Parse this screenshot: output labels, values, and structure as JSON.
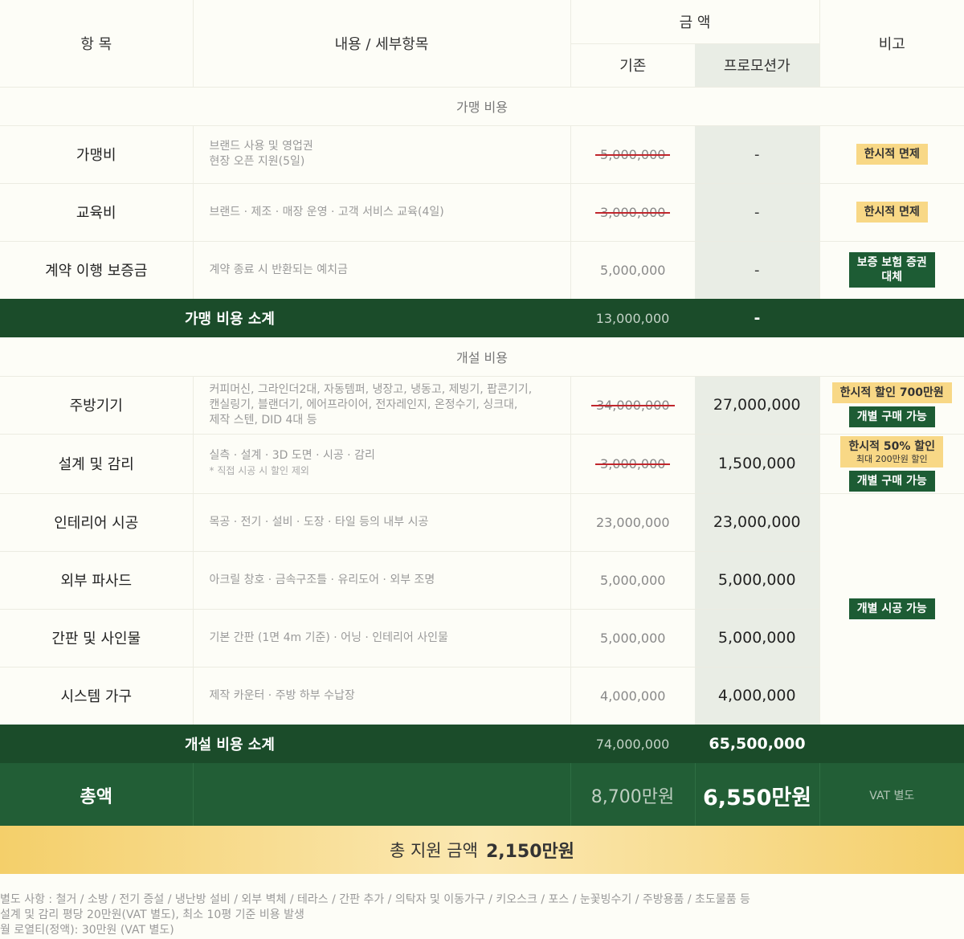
{
  "header": {
    "item": "항 목",
    "detail": "내용 / 세부항목",
    "amount": "금 액",
    "base": "기존",
    "promo": "프로모션가",
    "remark": "비고"
  },
  "franchise": {
    "section_label": "가맹 비용",
    "rows": [
      {
        "item": "가맹비",
        "desc1": "브랜드 사용 및 영업권",
        "desc2": "현장 오픈 지원(5일)",
        "base": "5,000,000",
        "promo": "-",
        "badge": "한시적 면제"
      },
      {
        "item": "교육비",
        "desc1": "브랜드 · 제조 · 매장 운영 · 고객 서비스 교육(4일)",
        "base": "3,000,000",
        "promo": "-",
        "badge": "한시적 면제"
      },
      {
        "item": "계약 이행 보증금",
        "desc1": "계약 종료 시 반환되는 예치금",
        "base": "5,000,000",
        "promo": "-",
        "badge1": "보증 보험 증권",
        "badge2": "대체"
      }
    ],
    "subtotal": {
      "label": "가맹 비용 소계",
      "base": "13,000,000",
      "promo": "-"
    }
  },
  "opening": {
    "section_label": "개설 비용",
    "rows": [
      {
        "item": "주방기기",
        "desc1": "커피머신, 그라인더2대, 자동템퍼, 냉장고, 냉동고, 제빙기, 팝콘기기,",
        "desc2": "캔실링기, 블랜더기, 에어프라이어, 전자레인지, 온정수기, 싱크대,",
        "desc3": "제작 스텐, DID 4대 등",
        "base": "34,000,000",
        "promo": "27,000,000",
        "badge1": "한시적 할인 700만원",
        "badge2": "개별 구매 가능"
      },
      {
        "item": "설계 및 감리",
        "desc1": "실측 · 설계 · 3D 도면 · 시공 · 감리",
        "note": "* 직접 시공 시 할인 제외",
        "base": "3,000,000",
        "promo": "1,500,000",
        "badge1": "한시적 50% 할인",
        "badge1_sub": "최대 200만원 할인",
        "badge2": "개별 구매 가능"
      },
      {
        "item": "인테리어 시공",
        "desc1": "목공 · 전기 · 설비 · 도장 · 타일 등의 내부 시공",
        "base": "23,000,000",
        "promo": "23,000,000"
      },
      {
        "item": "외부 파사드",
        "desc1": "아크릴 창호 · 금속구조틀 · 유리도어 · 외부 조명",
        "base": "5,000,000",
        "promo": "5,000,000"
      },
      {
        "item": "간판 및 사인물",
        "desc1": "기본 간판 (1면 4m 기준) · 어닝 · 인테리어 사인물",
        "base": "5,000,000",
        "promo": "5,000,000"
      },
      {
        "item": "시스템 가구",
        "desc1": "제작 카운터 · 주방 하부 수납장",
        "base": "4,000,000",
        "promo": "4,000,000"
      }
    ],
    "merged_badge": "개별 시공 가능",
    "subtotal": {
      "label": "개설 비용 소계",
      "base": "74,000,000",
      "promo": "65,500,000"
    }
  },
  "grand_total": {
    "label": "총액",
    "base": "8,700만원",
    "promo": "6,550만원",
    "vat": "VAT 별도"
  },
  "support": {
    "label": "총 지원 금액",
    "amount": "2,150만원"
  },
  "notes": [
    "별도 사항 : 철거 / 소방 / 전기 증설 / 냉난방 설비 / 외부 벽체 / 테라스 / 간판 추가 / 의탁자 및 이동가구 / 키오스크 / 포스 / 눈꽃빙수기 / 주방용품 / 초도물품 등",
    "설계 및 감리 평당 20만원(VAT 별도), 최소 10평 기준 비용 발생",
    "월 로열티(정액): 30만원 (VAT 별도)"
  ],
  "colors": {
    "dark_green": "#1b4c2a",
    "green": "#225e36",
    "gold": "#f8d886",
    "strike_red": "#c0272d"
  }
}
